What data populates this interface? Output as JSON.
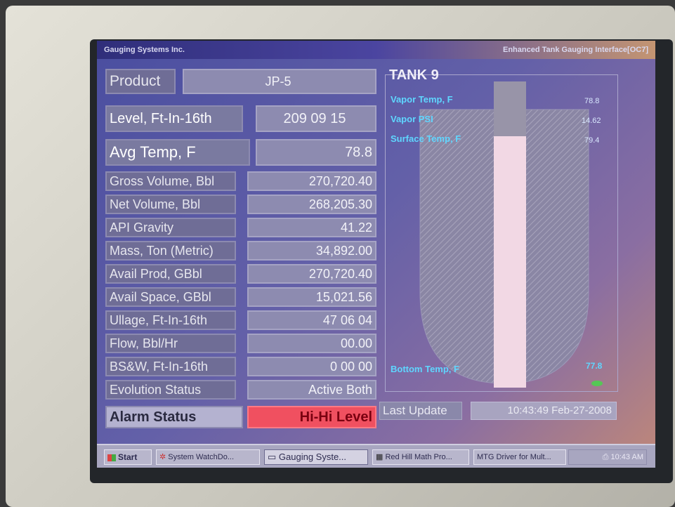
{
  "window": {
    "app_title": "Gauging Systems Inc.",
    "interface_title": "Enhanced Tank Gauging Interface[OC7]"
  },
  "panel": {
    "product_label": "Product",
    "product_value": "JP-5",
    "level_label": "Level, Ft-In-16th",
    "level_value": "209 09 15",
    "avg_temp_label": "Avg Temp, F",
    "avg_temp_value": "78.8",
    "rows": [
      {
        "label": "Gross Volume, Bbl",
        "value": "270,720.40"
      },
      {
        "label": "Net Volume, Bbl",
        "value": "268,205.30"
      },
      {
        "label": "API Gravity",
        "value": "41.22"
      },
      {
        "label": "Mass, Ton (Metric)",
        "value": "34,892.00"
      },
      {
        "label": "Avail Prod, GBbl",
        "value": "270,720.40"
      },
      {
        "label": "Avail Space, GBbl",
        "value": "15,021.56"
      },
      {
        "label": "Ullage, Ft-In-16th",
        "value": "47 06 04"
      },
      {
        "label": "Flow, Bbl/Hr",
        "value": "00.00"
      },
      {
        "label": "BS&W, Ft-In-16th",
        "value": "0 00 00"
      },
      {
        "label": "Evolution Status",
        "value": "Active Both"
      }
    ],
    "alarm_label": "Alarm Status",
    "alarm_value": "Hi-Hi Level"
  },
  "tank": {
    "title": "TANK 9",
    "fill_fraction": 0.82,
    "vapor_temp_label": "Vapor Temp, F",
    "vapor_temp_value": "78.8",
    "vapor_psi_label": "Vapor PSI",
    "vapor_psi_value": "14.62",
    "surface_temp_label": "Surface Temp, F",
    "surface_temp_value": "79.4",
    "bottom_temp_label": "Bottom Temp, F",
    "bottom_temp_value": "77.8"
  },
  "last_update": {
    "label": "Last Update",
    "value": "10:43:49 Feb-27-2008"
  },
  "taskbar": {
    "start": "Start",
    "items": [
      "System WatchDo...",
      "Gauging Syste...",
      "Red Hill Math Pro...",
      "MTG Driver for Mult..."
    ],
    "clock": "10:43 AM"
  },
  "colors": {
    "alarm": "#f05060",
    "tank_label": "#5fd6ff",
    "liquid_column": "#f2d8e4"
  }
}
